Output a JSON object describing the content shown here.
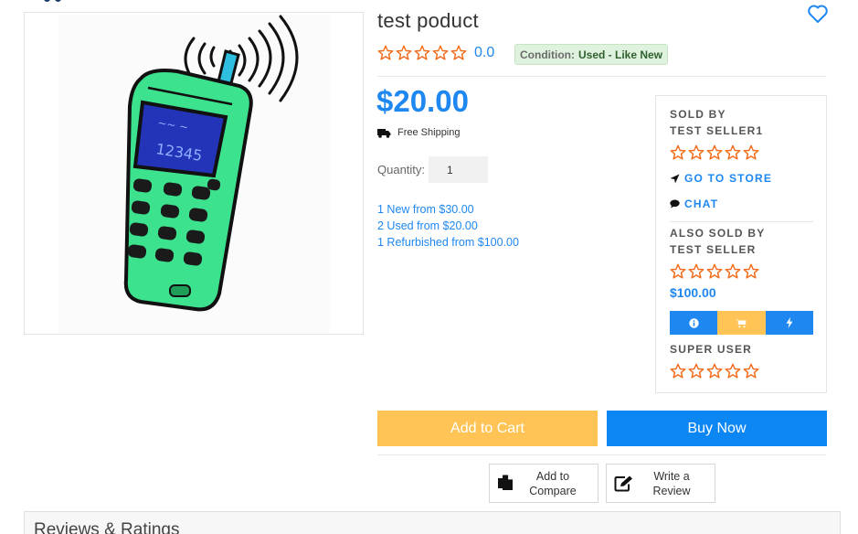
{
  "product": {
    "title": "test poduct",
    "rating": "0.0",
    "condition_label": "Condition:",
    "condition_value": "Used - Like New",
    "price": "$20.00",
    "shipping": "Free Shipping",
    "quantity_label": "Quantity:",
    "quantity_value": "1",
    "star_count": 5,
    "rating_value": 0
  },
  "offers": [
    "1 New from $30.00",
    "2 Used from $20.00",
    "1 Refurbished from $100.00"
  ],
  "seller": {
    "sold_by_label": "SOLD BY",
    "name": "TEST SELLER1",
    "go_to_store": "GO TO STORE",
    "chat": "CHAT",
    "rating_value": 0
  },
  "also_sold": {
    "label": "ALSO SOLD BY",
    "name": "TEST SELLER",
    "price": "$100.00",
    "rating_value": 0,
    "action_icons": [
      "info-icon",
      "cart-icon",
      "lightning-icon"
    ],
    "next_seller": "SUPER USER",
    "next_rating_value": 0
  },
  "actions": {
    "add_to_cart": "Add to Cart",
    "buy_now": "Buy Now",
    "compare_line1": "Add to",
    "compare_line2": "Compare",
    "review_line1": "Write a",
    "review_line2": "Review"
  },
  "reviews": {
    "title": "Reviews & Ratings"
  },
  "colors": {
    "accent": "#1e87f0",
    "gold": "#ffc455",
    "star": "#f36c1c",
    "condition_bg": "#dff2dd"
  }
}
